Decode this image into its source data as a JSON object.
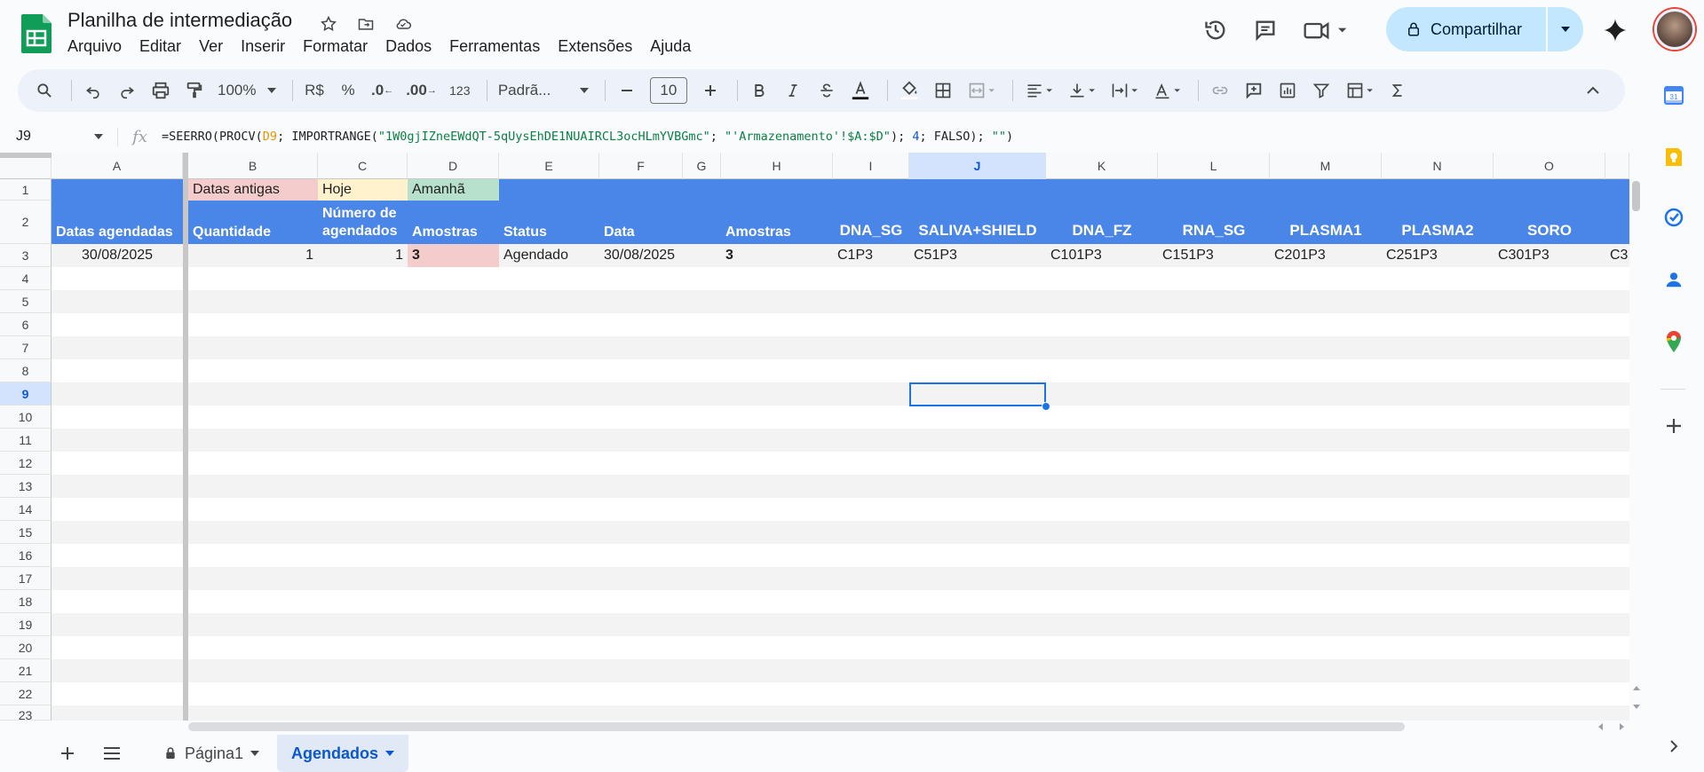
{
  "app": {
    "title": "Planilha de intermediação",
    "menu": [
      "Arquivo",
      "Editar",
      "Ver",
      "Inserir",
      "Formatar",
      "Dados",
      "Ferramentas",
      "Extensões",
      "Ajuda"
    ],
    "share_label": "Compartilhar"
  },
  "toolbar": {
    "zoom": "100%",
    "currency": "R$",
    "percent": "%",
    "dec_decrease": ".0",
    "dec_increase": ".00",
    "number_format": "123",
    "font": "Padrã...",
    "font_size": "10"
  },
  "formula_bar": {
    "cell_ref": "J9",
    "fx": "fx",
    "formula_parts": {
      "p1": "=SEERRO(PROCV(",
      "ref": "D9",
      "p2": "; IMPORTRANGE(",
      "str1": "\"1W0gjIZneEWdQT-5qUysEhDE1NUAIRCL3ocHLmYVBGmc\"",
      "p3": "; ",
      "str2": "\"'Armazenamento'!$A:$D\"",
      "p4": "); ",
      "num": "4",
      "p5": "; FALSO); ",
      "str3": "\"\"",
      "p6": ")"
    }
  },
  "columns": [
    "A",
    "B",
    "C",
    "D",
    "E",
    "F",
    "G",
    "H",
    "I",
    "J",
    "K",
    "L",
    "M",
    "N",
    "O"
  ],
  "rows": [
    "1",
    "2",
    "3",
    "4",
    "5",
    "6",
    "7",
    "8",
    "9",
    "10",
    "11",
    "12",
    "13",
    "14",
    "15",
    "16",
    "17",
    "18",
    "19",
    "20",
    "21",
    "22",
    "23"
  ],
  "legend": {
    "old": "Datas antigas",
    "today": "Hoje",
    "tomorrow": "Amanhã",
    "old_color": "#f4cccc",
    "today_color": "#fff2cc",
    "tomorrow_color": "#b7e1cd"
  },
  "headers": {
    "a": "Datas agendadas",
    "b": "Quantidade",
    "c_line1": "Número de",
    "c_line2": "agendados",
    "d": "Amostras",
    "e": "Status",
    "f": "Data",
    "h": "Amostras",
    "i": "DNA_SG",
    "j": "SALIVA+SHIELD",
    "k": "DNA_FZ",
    "l": "RNA_SG",
    "m": "PLASMA1",
    "n": "PLASMA2",
    "o": "SORO",
    "band_color": "#4a86e8"
  },
  "row3": {
    "a": "30/08/2025",
    "b": "1",
    "c": "1",
    "d": "3",
    "e": "Agendado",
    "f": "30/08/2025",
    "h": "3",
    "i": "C1P3",
    "j": "C51P3",
    "k": "C101P3",
    "l": "C151P3",
    "m": "C201P3",
    "n": "C251P3",
    "o": "C301P3",
    "p": "C3"
  },
  "sheets": {
    "tab1": "Página1",
    "tab2": "Agendados"
  }
}
